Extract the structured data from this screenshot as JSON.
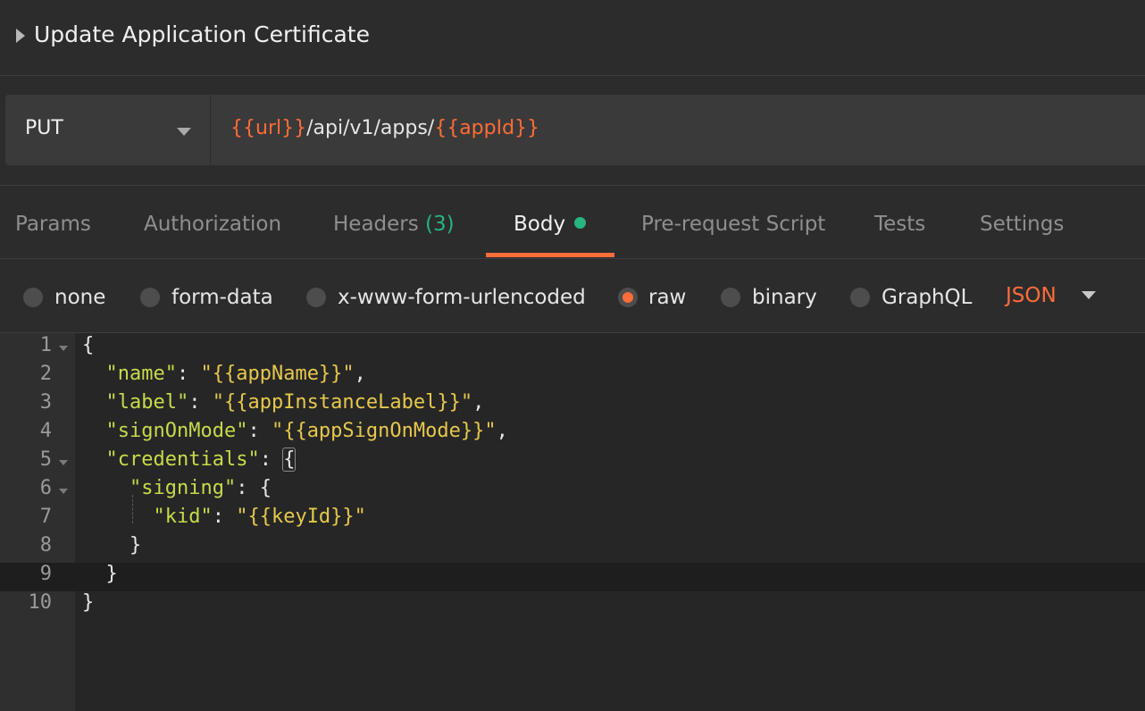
{
  "header": {
    "title": "Update Application Certificate"
  },
  "request": {
    "method": "PUT",
    "url_parts": [
      "{{url}}",
      "/api/v1/apps/",
      "{{appId}}"
    ]
  },
  "tabs": [
    {
      "label": "Params"
    },
    {
      "label": "Authorization"
    },
    {
      "label": "Headers",
      "count": "(3)"
    },
    {
      "label": "Body"
    },
    {
      "label": "Pre-request Script"
    },
    {
      "label": "Tests"
    },
    {
      "label": "Settings"
    }
  ],
  "body_types": [
    {
      "label": "none",
      "selected": false
    },
    {
      "label": "form-data",
      "selected": false
    },
    {
      "label": "x-www-form-urlencoded",
      "selected": false
    },
    {
      "label": "raw",
      "selected": true
    },
    {
      "label": "binary",
      "selected": false
    },
    {
      "label": "GraphQL",
      "selected": false
    }
  ],
  "format": "JSON",
  "editor": {
    "line_numbers": [
      "1",
      "2",
      "3",
      "4",
      "5",
      "6",
      "7",
      "8",
      "9",
      "10"
    ],
    "lines": [
      {
        "tokens": [
          [
            "p",
            "{"
          ]
        ]
      },
      {
        "tokens": [
          [
            "p",
            "  "
          ],
          [
            "k",
            "\"name\""
          ],
          [
            "p",
            ": "
          ],
          [
            "s",
            "\"{{appName}}\""
          ],
          [
            "p",
            ","
          ]
        ]
      },
      {
        "tokens": [
          [
            "p",
            "  "
          ],
          [
            "k",
            "\"label\""
          ],
          [
            "p",
            ": "
          ],
          [
            "s",
            "\"{{appInstanceLabel}}\""
          ],
          [
            "p",
            ","
          ]
        ]
      },
      {
        "tokens": [
          [
            "p",
            "  "
          ],
          [
            "k",
            "\"signOnMode\""
          ],
          [
            "p",
            ": "
          ],
          [
            "s",
            "\"{{appSignOnMode}}\""
          ],
          [
            "p",
            ","
          ]
        ]
      },
      {
        "tokens": [
          [
            "p",
            "  "
          ],
          [
            "k",
            "\"credentials\""
          ],
          [
            "p",
            ": "
          ],
          [
            "b",
            "{"
          ]
        ]
      },
      {
        "tokens": [
          [
            "p",
            "    "
          ],
          [
            "k",
            "\"signing\""
          ],
          [
            "p",
            ": {"
          ]
        ]
      },
      {
        "tokens": [
          [
            "p",
            "      "
          ],
          [
            "k",
            "\"kid\""
          ],
          [
            "p",
            ": "
          ],
          [
            "s",
            "\"{{keyId}}\""
          ]
        ]
      },
      {
        "tokens": [
          [
            "p",
            "    }"
          ]
        ]
      },
      {
        "tokens": [
          [
            "p",
            "  }"
          ]
        ]
      },
      {
        "tokens": [
          [
            "p",
            "}"
          ]
        ]
      }
    ]
  },
  "colors": {
    "accent": "#ff6c37",
    "success": "#26b47f",
    "json_key": "#c9d94b",
    "json_string": "#e6c84c"
  }
}
